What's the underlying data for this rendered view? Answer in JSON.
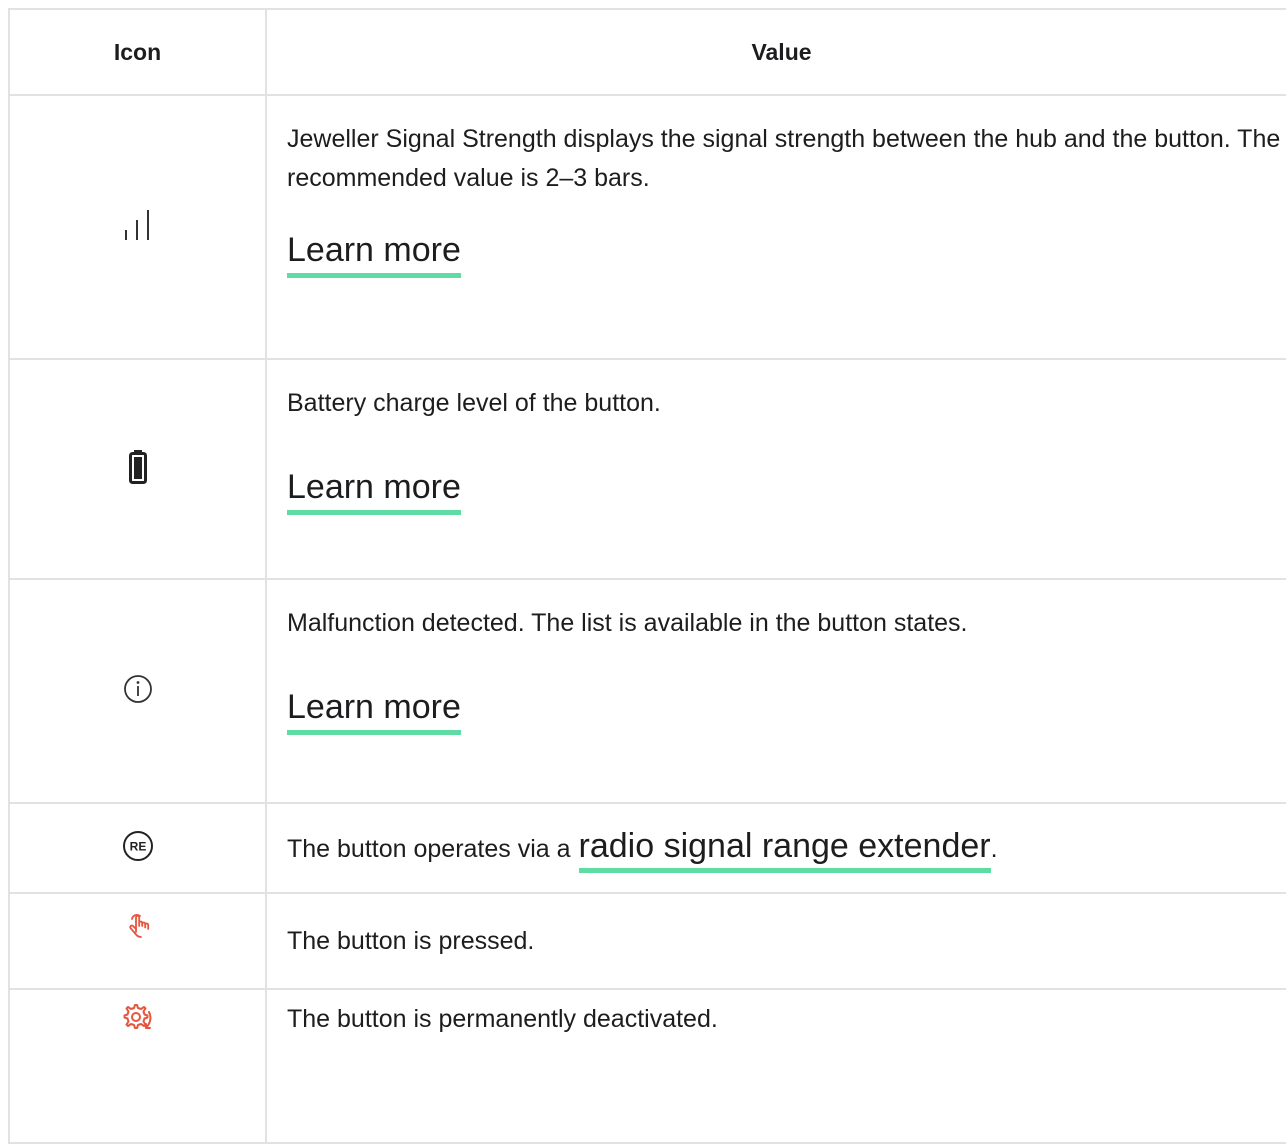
{
  "table": {
    "headers": {
      "icon": "Icon",
      "value": "Value"
    },
    "rows": [
      {
        "icon": "signal-strength-icon",
        "description": "Jeweller Signal Strength displays the signal strength between the hub and the button. The recommended value is 2–3 bars.",
        "link": "Learn more"
      },
      {
        "icon": "battery-icon",
        "description": "Battery charge level of the button.",
        "link": "Learn more"
      },
      {
        "icon": "info-icon",
        "description": "Malfunction detected. The list is available in the button states.",
        "link": "Learn more"
      },
      {
        "icon": "range-extender-icon",
        "icon_text": "RE",
        "description": "The button operates via a",
        "link": "radio signal range extender",
        "suffix": "."
      },
      {
        "icon": "hand-press-icon",
        "description": "The button is pressed."
      },
      {
        "icon": "gear-deactivated-icon",
        "description": "The button is permanently deactivated."
      }
    ]
  },
  "colors": {
    "link_underline": "#5fdca4",
    "alert_icon": "#e8553e",
    "border": "#e2e2e2",
    "text": "#1d1d1f"
  }
}
